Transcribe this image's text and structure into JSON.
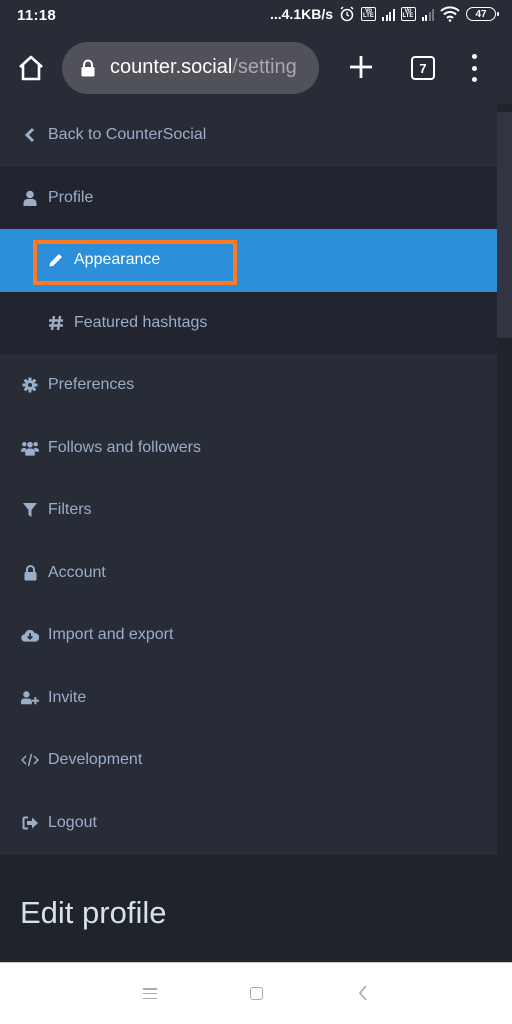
{
  "status_bar": {
    "time": "11:18",
    "network_speed": "...4.1KB/s",
    "volte_label": "Vo LTE",
    "battery": "47",
    "icons": [
      "alarm-icon",
      "volte-icon",
      "signal-icon",
      "volte-icon",
      "signal-icon",
      "wifi-icon",
      "battery-icon"
    ]
  },
  "browser": {
    "url_host": "counter.social",
    "url_path": "/setting",
    "tab_count": "7",
    "icons": [
      "home-icon",
      "lock-icon",
      "new-tab-icon",
      "tabs-icon",
      "more-menu-icon"
    ]
  },
  "nav": {
    "back": {
      "label": "Back to CounterSocial",
      "icon": "chevron-left-icon"
    },
    "profile": {
      "label": "Profile",
      "icon": "user-icon"
    },
    "appearance": {
      "label": "Appearance",
      "icon": "pencil-icon",
      "active": true
    },
    "featured_hashtags": {
      "label": "Featured hashtags",
      "icon": "hashtag-icon"
    },
    "items": [
      {
        "label": "Preferences",
        "icon": "gear-icon"
      },
      {
        "label": "Follows and followers",
        "icon": "users-icon"
      },
      {
        "label": "Filters",
        "icon": "filter-icon"
      },
      {
        "label": "Account",
        "icon": "lock-icon"
      },
      {
        "label": "Import and export",
        "icon": "cloud-download-icon"
      },
      {
        "label": "Invite",
        "icon": "user-plus-icon"
      },
      {
        "label": "Development",
        "icon": "code-icon"
      },
      {
        "label": "Logout",
        "icon": "sign-out-icon"
      }
    ]
  },
  "page": {
    "title": "Edit profile"
  },
  "colors": {
    "background": "#282c37",
    "group_background": "#22252f",
    "active": "#2b90d9",
    "highlight_border": "#ff7a22",
    "nav_text": "#9baec8"
  }
}
